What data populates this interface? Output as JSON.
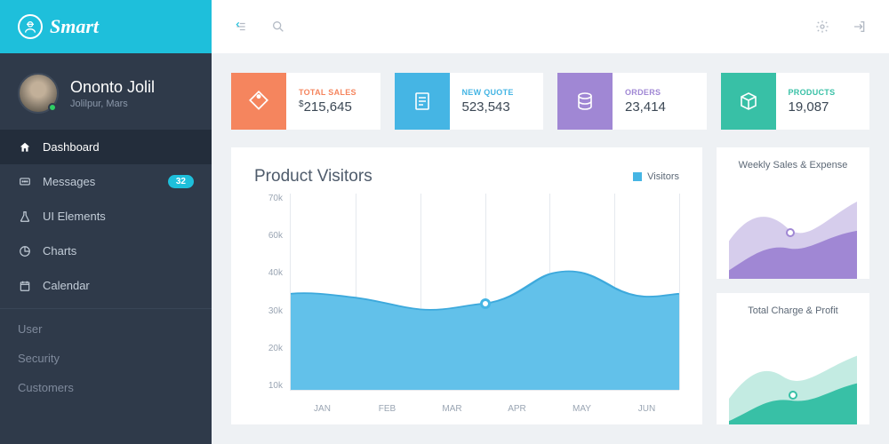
{
  "brand": {
    "name": "Smart"
  },
  "user": {
    "name": "Ononto Jolil",
    "location": "Jolilpur, Mars"
  },
  "nav": {
    "items": [
      {
        "label": "Dashboard",
        "icon": "home-icon"
      },
      {
        "label": "Messages",
        "icon": "message-icon",
        "badge": "32"
      },
      {
        "label": "UI Elements",
        "icon": "flask-icon"
      },
      {
        "label": "Charts",
        "icon": "pie-icon"
      },
      {
        "label": "Calendar",
        "icon": "calendar-icon"
      }
    ],
    "secondary": [
      "User",
      "Security",
      "Customers"
    ]
  },
  "stats": [
    {
      "label": "TOTAL SALES",
      "prefix": "$",
      "value": "215,645"
    },
    {
      "label": "NEW QUOTE",
      "value": "523,543"
    },
    {
      "label": "ORDERS",
      "value": "23,414"
    },
    {
      "label": "PRODUCTS",
      "value": "19,087"
    }
  ],
  "chart_data": {
    "type": "area",
    "title": "Product Visitors",
    "legend": "Visitors",
    "categories": [
      "JAN",
      "FEB",
      "MAR",
      "APR",
      "MAY",
      "JUN"
    ],
    "yticks": [
      "70k",
      "60k",
      "40k",
      "30k",
      "20k",
      "10k"
    ],
    "ylim": [
      0,
      70000
    ],
    "values": [
      34000,
      33000,
      29000,
      31000,
      41000,
      34000
    ],
    "marker_category": "APR"
  },
  "mini_charts": [
    {
      "title": "Weekly Sales & Expense"
    },
    {
      "title": "Total Charge & Profit"
    }
  ]
}
